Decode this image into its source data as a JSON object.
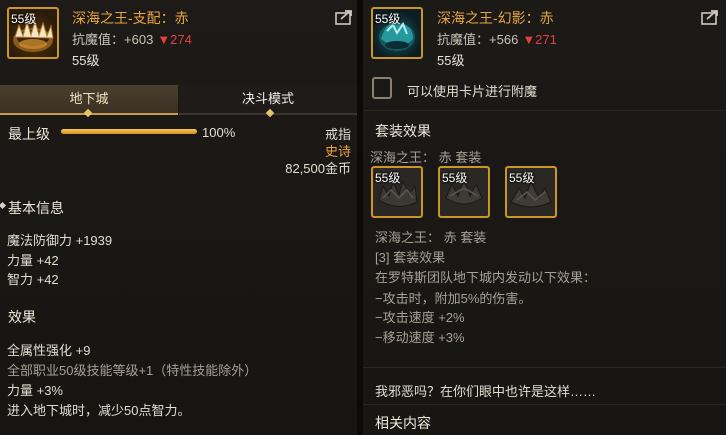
{
  "left": {
    "item": {
      "level_badge": "55级",
      "name": "深海之王-支配：赤",
      "resist_label": "抗魔值：",
      "resist_value": "+603",
      "resist_change": "▼274",
      "level": "55级"
    },
    "tabs": [
      "地下城",
      "决斗模式"
    ],
    "progress": {
      "label": "最上级",
      "percent_text": "100%",
      "value": 1.0
    },
    "slot": "戒指",
    "rarity": "史诗",
    "price": "82,500金币",
    "basic_info": {
      "header": "基本信息",
      "lines": [
        "魔法防御力 +1939",
        "力量 +42",
        "智力 +42"
      ]
    },
    "effects": {
      "header": "效果",
      "lines": [
        "全属性强化 +9",
        "全部职业50级技能等级+1（特性技能除外）",
        "力量 +3%",
        "进入地下城时，减少50点智力。"
      ]
    }
  },
  "right": {
    "item": {
      "level_badge": "55级",
      "name": "深海之王-幻影：赤",
      "resist_label": "抗魔值：",
      "resist_value": "+566",
      "resist_change": "▼271",
      "level": "55级"
    },
    "card_enchant": "可以使用卡片进行附魔",
    "set_effect": {
      "header": "套装效果",
      "set_name": "深海之王： 赤 套装",
      "pieces": [
        "55级",
        "55级",
        "55级"
      ],
      "set_name2": "深海之王： 赤 套装",
      "count_label": "[3] 套装效果",
      "lines": [
        "在罗特斯团队地下城内发动以下效果：",
        "−攻击时，附加5%的伤害。",
        "−攻击速度 +2%",
        "−移动速度 +3%"
      ]
    },
    "quote": "我邪恶吗？在你们眼中也许是这样……",
    "related": "相关内容"
  },
  "colors": {
    "title": "#e9a640",
    "rarity": "#e9a640",
    "decrease": "#e0413c",
    "frame": "#c8962a"
  }
}
